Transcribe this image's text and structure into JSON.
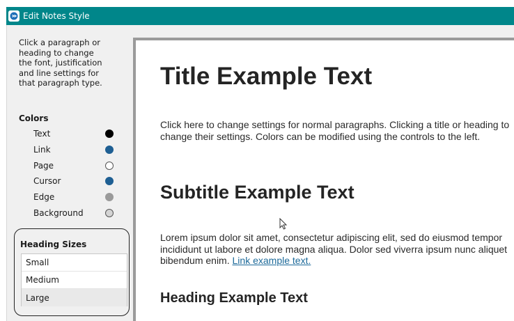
{
  "window": {
    "title": "Edit Notes Style"
  },
  "sidebar": {
    "help_text": "Click a paragraph or heading to change the font, justification and line settings for that paragraph type.",
    "colors_title": "Colors",
    "colors": [
      {
        "label": "Text",
        "color": "#000000",
        "border": "#000000"
      },
      {
        "label": "Link",
        "color": "#1e5f93",
        "border": "#1e5f93"
      },
      {
        "label": "Page",
        "color": "#ffffff",
        "border": "#555555"
      },
      {
        "label": "Cursor",
        "color": "#1e5f93",
        "border": "#1e5f93"
      },
      {
        "label": "Edge",
        "color": "#9a9a9a",
        "border": "#9a9a9a"
      },
      {
        "label": "Background",
        "color": "#d4d4d4",
        "border": "#555555"
      }
    ],
    "heading_sizes": {
      "title": "Heading Sizes",
      "options": [
        "Small",
        "Medium",
        "Large"
      ],
      "selected": "Large"
    }
  },
  "preview": {
    "title": "Title Example Text",
    "paragraph1": "Click here to change settings for normal paragraphs. Clicking a title or heading to change their settings. Colors can be modified using the controls to the left.",
    "subtitle": "Subtitle Example Text",
    "paragraph2": "Lorem ipsum dolor sit amet, consectetur adipiscing elit, sed do eiusmod tempor incididunt ut labore et dolore magna aliqua. Dolor sed viverra ipsum nunc aliquet bibendum enim.",
    "link_text": "Link example text.",
    "heading": "Heading Example Text"
  },
  "colors": {
    "titlebar": "#00868a",
    "link": "#1d6a9a",
    "edge": "#9a9a9a"
  }
}
